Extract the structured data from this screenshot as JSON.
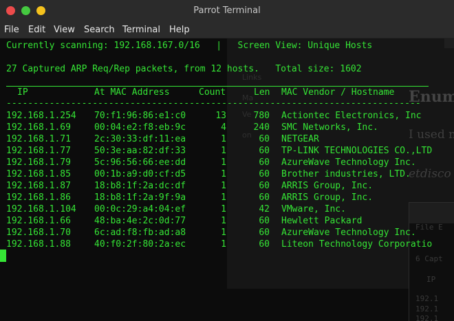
{
  "window": {
    "title": "Parrot Terminal",
    "colors": {
      "close": "#ed4b4b",
      "maximize": "#45c940",
      "minimize": "#f5c21d",
      "terminal_text": "#35e635",
      "terminal_bg": "#0c0c0c"
    }
  },
  "menubar": {
    "items": [
      "File",
      "Edit",
      "View",
      "Search",
      "Terminal",
      "Help"
    ]
  },
  "terminal": {
    "scan_line": "Currently scanning: 192.168.167.0/16   |   Screen View: Unique Hosts",
    "stats_line": "27 Captured ARP Req/Rep packets, from 12 hosts.   Total size: 1602",
    "headers": {
      "ip": "IP",
      "mac": "At MAC Address",
      "count": "Count",
      "len": "Len",
      "vendor": "MAC Vendor / Hostname"
    },
    "divider": "-----------------------------------------------------------------------------",
    "rows": [
      {
        "ip": "192.168.1.254",
        "mac": "70:f1:96:86:e1:c0",
        "count": "13",
        "len": "780",
        "vendor": "Actiontec Electronics, Inc"
      },
      {
        "ip": "192.168.1.69",
        "mac": "00:04:e2:f8:eb:9c",
        "count": "4",
        "len": "240",
        "vendor": "SMC Networks, Inc."
      },
      {
        "ip": "192.168.1.71",
        "mac": "2c:30:33:df:11:ea",
        "count": "1",
        "len": "60",
        "vendor": "NETGEAR"
      },
      {
        "ip": "192.168.1.77",
        "mac": "50:3e:aa:82:df:33",
        "count": "1",
        "len": "60",
        "vendor": "TP-LINK TECHNOLOGIES CO.,LTD"
      },
      {
        "ip": "192.168.1.79",
        "mac": "5c:96:56:66:ee:dd",
        "count": "1",
        "len": "60",
        "vendor": "AzureWave Technology Inc."
      },
      {
        "ip": "192.168.1.85",
        "mac": "00:1b:a9:d0:cf:d5",
        "count": "1",
        "len": "60",
        "vendor": "Brother industries, LTD."
      },
      {
        "ip": "192.168.1.87",
        "mac": "18:b8:1f:2a:dc:df",
        "count": "1",
        "len": "60",
        "vendor": "ARRIS Group, Inc."
      },
      {
        "ip": "192.168.1.86",
        "mac": "18:b8:1f:2a:9f:9a",
        "count": "1",
        "len": "60",
        "vendor": "ARRIS Group, Inc."
      },
      {
        "ip": "192.168.1.104",
        "mac": "00:0c:29:a4:04:ef",
        "count": "1",
        "len": "42",
        "vendor": "VMware, Inc."
      },
      {
        "ip": "192.168.1.66",
        "mac": "48:ba:4e:2c:0d:77",
        "count": "1",
        "len": "60",
        "vendor": "Hewlett Packard"
      },
      {
        "ip": "192.168.1.70",
        "mac": "6c:ad:f8:fb:ad:a8",
        "count": "1",
        "len": "60",
        "vendor": "AzureWave Technology Inc."
      },
      {
        "ip": "192.168.1.88",
        "mac": "40:f0:2f:80:2a:ec",
        "count": "1",
        "len": "60",
        "vendor": "Liteon Technology Corporatio"
      }
    ]
  },
  "background": {
    "heading": "Enum",
    "line1": "I used ne",
    "line2": "etdisco",
    "side1": "Links",
    "side2": "Ma",
    "side3": "Ve",
    "side4": "on"
  },
  "background_window": {
    "menu": "File E",
    "line1": "6 Capt",
    "line2": "IP",
    "line3": "192.1",
    "line4": "192.1",
    "line5": "192.1"
  }
}
